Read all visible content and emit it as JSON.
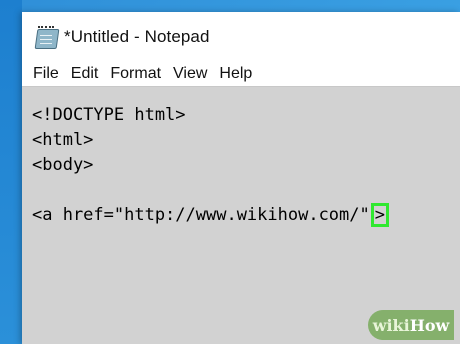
{
  "window": {
    "title": "*Untitled - Notepad",
    "icon": "notepad-icon"
  },
  "menu": {
    "items": [
      "File",
      "Edit",
      "Format",
      "View",
      "Help"
    ]
  },
  "editor": {
    "lines": [
      "<!DOCTYPE html>",
      "<html>",
      "<body>",
      "",
      "<a href=\"http://www.wikihow.com/\""
    ],
    "highlighted_char": ">",
    "highlight_color": "#30e830",
    "background": "#d2d2d2"
  },
  "watermark": {
    "part1": "wiki",
    "part2": "How"
  }
}
